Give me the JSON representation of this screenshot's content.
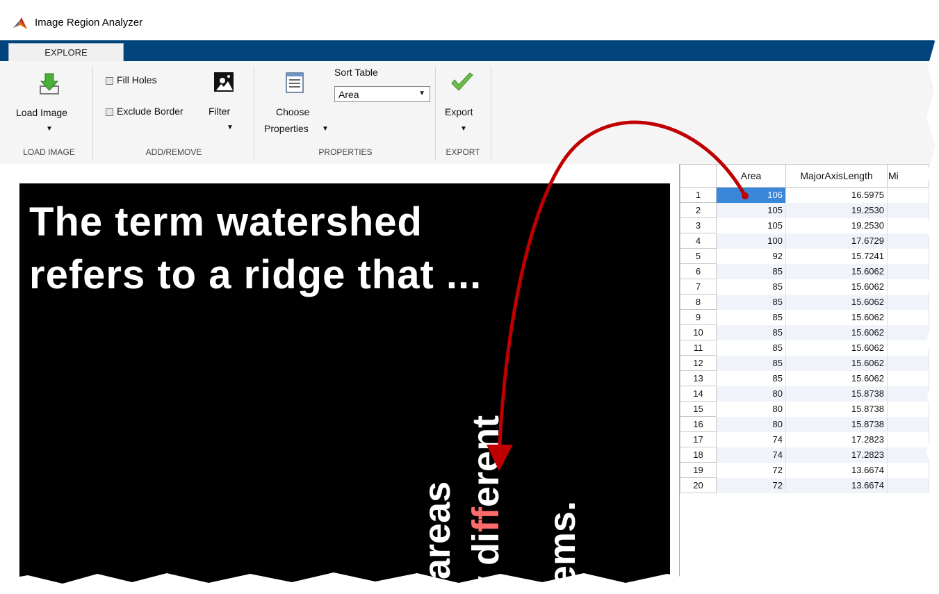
{
  "window": {
    "title": "Image Region Analyzer"
  },
  "tabs": [
    {
      "label": "EXPLORE"
    }
  ],
  "ribbon": {
    "load_image": {
      "label": "Load Image",
      "group": "LOAD IMAGE"
    },
    "add_remove": {
      "fill_holes": "Fill Holes",
      "exclude_border": "Exclude Border",
      "filter": "Filter",
      "group": "ADD/REMOVE"
    },
    "properties": {
      "choose_line1": "Choose",
      "choose_line2": "Properties",
      "sort_label": "Sort Table",
      "sort_value": "Area",
      "group": "PROPERTIES"
    },
    "export": {
      "label": "Export",
      "group": "EXPORT"
    }
  },
  "image_text": {
    "line1": "The term watershed",
    "line2": "refers to a ridge that ...",
    "vert1": "areas",
    "vert2_a": "y di",
    "vert2_hl": "ff",
    "vert2_b": "erent",
    "vert3": "ems."
  },
  "table": {
    "headers": [
      "Area",
      "MajorAxisLength",
      "Mi"
    ],
    "rows": [
      [
        "1",
        "106",
        "16.5975"
      ],
      [
        "2",
        "105",
        "19.2530"
      ],
      [
        "3",
        "105",
        "19.2530"
      ],
      [
        "4",
        "100",
        "17.6729"
      ],
      [
        "5",
        "92",
        "15.7241"
      ],
      [
        "6",
        "85",
        "15.6062"
      ],
      [
        "7",
        "85",
        "15.6062"
      ],
      [
        "8",
        "85",
        "15.6062"
      ],
      [
        "9",
        "85",
        "15.6062"
      ],
      [
        "10",
        "85",
        "15.6062"
      ],
      [
        "11",
        "85",
        "15.6062"
      ],
      [
        "12",
        "85",
        "15.6062"
      ],
      [
        "13",
        "85",
        "15.6062"
      ],
      [
        "14",
        "80",
        "15.8738"
      ],
      [
        "15",
        "80",
        "15.8738"
      ],
      [
        "16",
        "80",
        "15.8738"
      ],
      [
        "17",
        "74",
        "17.2823"
      ],
      [
        "18",
        "74",
        "17.2823"
      ],
      [
        "19",
        "72",
        "13.6674"
      ],
      [
        "20",
        "72",
        "13.6674"
      ]
    ]
  },
  "colors": {
    "tabbar": "#01447b",
    "selection": "#3a86d9",
    "arrow": "#c00000",
    "highlight": "#ff6b6b"
  }
}
